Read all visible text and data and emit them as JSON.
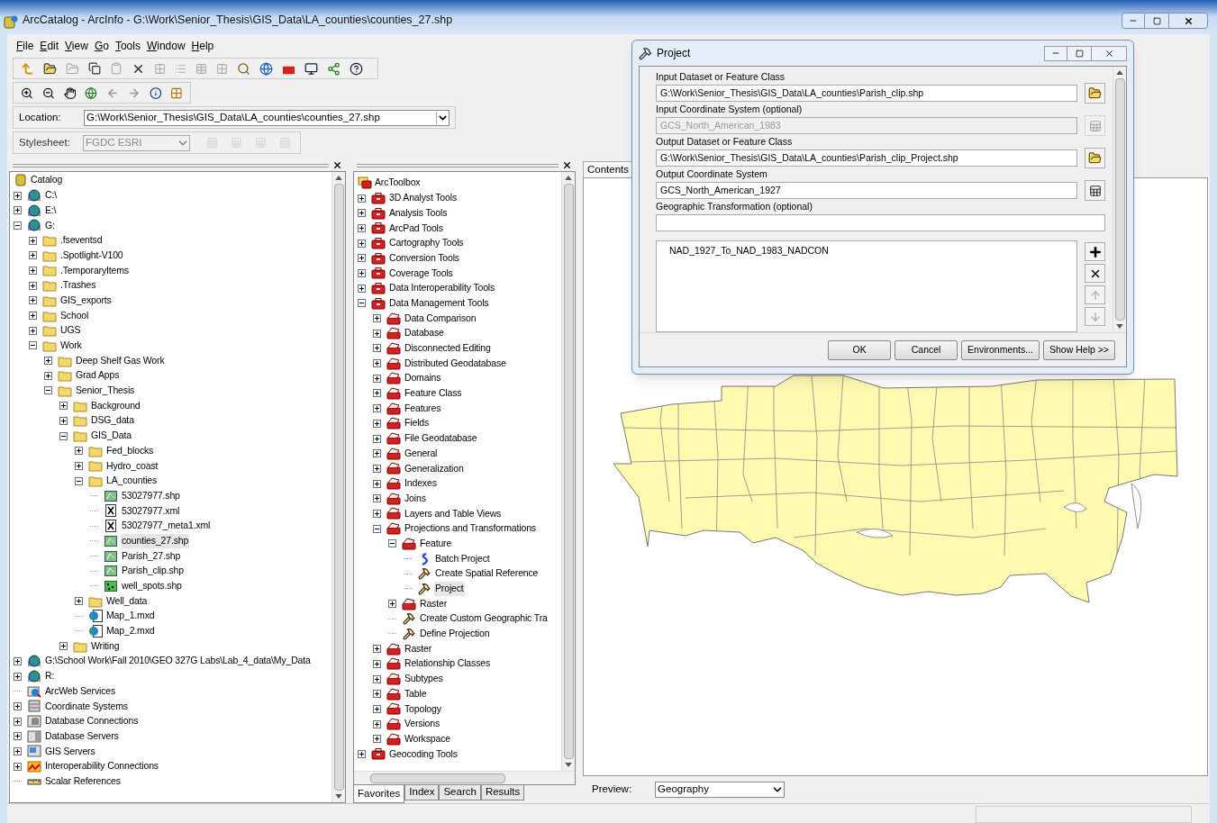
{
  "window": {
    "title": "ArcCatalog - ArcInfo - G:\\Work\\Senior_Thesis\\GIS_Data\\LA_counties\\counties_27.shp"
  },
  "menu": [
    "File",
    "Edit",
    "View",
    "Go",
    "Tools",
    "Window",
    "Help"
  ],
  "location": {
    "label": "Location:",
    "value": "G:\\Work\\Senior_Thesis\\GIS_Data\\LA_counties\\counties_27.shp"
  },
  "stylesheet": {
    "label": "Stylesheet:",
    "value": "FGDC ESRI",
    "disabled": true
  },
  "catalog": {
    "root": {
      "label": "Catalog",
      "kind": "catalog"
    },
    "items": [
      {
        "label": "C:\\",
        "kind": "drive",
        "expanded": false,
        "selected": false
      },
      {
        "label": "E:\\",
        "kind": "drive",
        "expanded": false,
        "selected": false
      },
      {
        "label": "G:",
        "kind": "drive",
        "expanded": true,
        "selected": false,
        "children": [
          {
            "label": ".fseventsd",
            "kind": "folder",
            "expanded": false,
            "selected": false
          },
          {
            "label": ".Spotlight-V100",
            "kind": "folder",
            "expanded": false,
            "selected": false
          },
          {
            "label": ".TemporaryItems",
            "kind": "folder",
            "expanded": false,
            "selected": false
          },
          {
            "label": ".Trashes",
            "kind": "folder",
            "expanded": false,
            "selected": false
          },
          {
            "label": "GIS_exports",
            "kind": "folder",
            "expanded": false,
            "selected": false
          },
          {
            "label": "School",
            "kind": "folder",
            "expanded": false,
            "selected": false
          },
          {
            "label": "UGS",
            "kind": "folder",
            "expanded": false,
            "selected": false
          },
          {
            "label": "Work",
            "kind": "folder",
            "expanded": true,
            "selected": false,
            "children": [
              {
                "label": "Deep Shelf Gas Work",
                "kind": "folder",
                "expanded": false,
                "selected": false
              },
              {
                "label": "Grad Apps",
                "kind": "folder",
                "expanded": false,
                "selected": false
              },
              {
                "label": "Senior_Thesis",
                "kind": "folder",
                "expanded": true,
                "selected": false,
                "children": [
                  {
                    "label": "Background",
                    "kind": "folder",
                    "expanded": false,
                    "selected": false
                  },
                  {
                    "label": "DSG_data",
                    "kind": "folder",
                    "expanded": false,
                    "selected": false
                  },
                  {
                    "label": "GIS_Data",
                    "kind": "folder",
                    "expanded": true,
                    "selected": false,
                    "children": [
                      {
                        "label": "Fed_blocks",
                        "kind": "folder",
                        "expanded": false,
                        "selected": false
                      },
                      {
                        "label": "Hydro_coast",
                        "kind": "folder",
                        "expanded": false,
                        "selected": false
                      },
                      {
                        "label": "LA_counties",
                        "kind": "folder",
                        "expanded": true,
                        "selected": false,
                        "children": [
                          {
                            "label": "53027977.shp",
                            "kind": "shapefile",
                            "selected": false
                          },
                          {
                            "label": "53027977.xml",
                            "kind": "xml",
                            "selected": false
                          },
                          {
                            "label": "53027977_meta1.xml",
                            "kind": "xml",
                            "selected": false
                          },
                          {
                            "label": "counties_27.shp",
                            "kind": "shapefile",
                            "selected": true
                          },
                          {
                            "label": "Parish_27.shp",
                            "kind": "shapefile",
                            "selected": false
                          },
                          {
                            "label": "Parish_clip.shp",
                            "kind": "shapefile",
                            "selected": false
                          },
                          {
                            "label": "well_spots.shp",
                            "kind": "points",
                            "selected": false
                          }
                        ]
                      },
                      {
                        "label": "Well_data",
                        "kind": "folder",
                        "expanded": false,
                        "selected": false
                      },
                      {
                        "label": "Map_1.mxd",
                        "kind": "mxd",
                        "selected": false
                      },
                      {
                        "label": "Map_2.mxd",
                        "kind": "mxd",
                        "selected": false
                      }
                    ]
                  },
                  {
                    "label": "Writing",
                    "kind": "folder",
                    "expanded": false,
                    "selected": false
                  }
                ]
              }
            ]
          }
        ]
      },
      {
        "label": "G:\\School Work\\Fall 2010\\GEO 327G Labs\\Lab_4_data\\My_Data",
        "kind": "drive",
        "expanded": false,
        "selected": false
      },
      {
        "label": "R:",
        "kind": "drive",
        "expanded": false,
        "selected": false
      },
      {
        "label": "ArcWeb Services",
        "kind": "service",
        "selected": false
      },
      {
        "label": "Coordinate Systems",
        "kind": "coordsys",
        "expanded": false,
        "selected": false
      },
      {
        "label": "Database Connections",
        "kind": "dbconn",
        "expanded": false,
        "selected": false
      },
      {
        "label": "Database Servers",
        "kind": "dbserver",
        "expanded": false,
        "selected": false
      },
      {
        "label": "GIS Servers",
        "kind": "gisserver",
        "expanded": false,
        "selected": false
      },
      {
        "label": "Interoperability Connections",
        "kind": "interop",
        "expanded": false,
        "selected": false
      },
      {
        "label": "Scalar References",
        "kind": "scalar",
        "selected": false
      }
    ]
  },
  "toolbox": {
    "root": {
      "label": "ArcToolbox",
      "kind": "arctoolbox"
    },
    "items": [
      {
        "label": "3D Analyst Tools",
        "kind": "toolbox",
        "expanded": false,
        "selected": false
      },
      {
        "label": "Analysis Tools",
        "kind": "toolbox",
        "expanded": false,
        "selected": false
      },
      {
        "label": "ArcPad Tools",
        "kind": "toolbox",
        "expanded": false,
        "selected": false
      },
      {
        "label": "Cartography Tools",
        "kind": "toolbox",
        "expanded": false,
        "selected": false
      },
      {
        "label": "Conversion Tools",
        "kind": "toolbox",
        "expanded": false,
        "selected": false
      },
      {
        "label": "Coverage Tools",
        "kind": "toolbox",
        "expanded": false,
        "selected": false
      },
      {
        "label": "Data Interoperability Tools",
        "kind": "toolbox",
        "expanded": false,
        "selected": false
      },
      {
        "label": "Data Management Tools",
        "kind": "toolbox",
        "expanded": true,
        "selected": false,
        "children": [
          {
            "label": "Data Comparison",
            "kind": "toolset",
            "expanded": false,
            "selected": false
          },
          {
            "label": "Database",
            "kind": "toolset",
            "expanded": false,
            "selected": false
          },
          {
            "label": "Disconnected Editing",
            "kind": "toolset",
            "expanded": false,
            "selected": false
          },
          {
            "label": "Distributed Geodatabase",
            "kind": "toolset",
            "expanded": false,
            "selected": false
          },
          {
            "label": "Domains",
            "kind": "toolset",
            "expanded": false,
            "selected": false
          },
          {
            "label": "Feature Class",
            "kind": "toolset",
            "expanded": false,
            "selected": false
          },
          {
            "label": "Features",
            "kind": "toolset",
            "expanded": false,
            "selected": false
          },
          {
            "label": "Fields",
            "kind": "toolset",
            "expanded": false,
            "selected": false
          },
          {
            "label": "File Geodatabase",
            "kind": "toolset",
            "expanded": false,
            "selected": false
          },
          {
            "label": "General",
            "kind": "toolset",
            "expanded": false,
            "selected": false
          },
          {
            "label": "Generalization",
            "kind": "toolset",
            "expanded": false,
            "selected": false
          },
          {
            "label": "Indexes",
            "kind": "toolset",
            "expanded": false,
            "selected": false
          },
          {
            "label": "Joins",
            "kind": "toolset",
            "expanded": false,
            "selected": false
          },
          {
            "label": "Layers and Table Views",
            "kind": "toolset",
            "expanded": false,
            "selected": false
          },
          {
            "label": "Projections and Transformations",
            "kind": "toolset",
            "expanded": true,
            "selected": false,
            "children": [
              {
                "label": "Feature",
                "kind": "toolset",
                "expanded": true,
                "selected": false,
                "children": [
                  {
                    "label": "Batch Project",
                    "kind": "batch",
                    "selected": false
                  },
                  {
                    "label": "Create Spatial Reference",
                    "kind": "tool",
                    "selected": false
                  },
                  {
                    "label": "Project",
                    "kind": "tool",
                    "selected": true
                  }
                ]
              },
              {
                "label": "Raster",
                "kind": "toolset",
                "expanded": false,
                "selected": false
              },
              {
                "label": "Create Custom Geographic Tra",
                "kind": "tool",
                "selected": false
              },
              {
                "label": "Define Projection",
                "kind": "tool",
                "selected": false
              }
            ]
          },
          {
            "label": "Raster",
            "kind": "toolset",
            "expanded": false,
            "selected": false
          },
          {
            "label": "Relationship Classes",
            "kind": "toolset",
            "expanded": false,
            "selected": false
          },
          {
            "label": "Subtypes",
            "kind": "toolset",
            "expanded": false,
            "selected": false
          },
          {
            "label": "Table",
            "kind": "toolset",
            "expanded": false,
            "selected": false
          },
          {
            "label": "Topology",
            "kind": "toolset",
            "expanded": false,
            "selected": false
          },
          {
            "label": "Versions",
            "kind": "toolset",
            "expanded": false,
            "selected": false
          },
          {
            "label": "Workspace",
            "kind": "toolset",
            "expanded": false,
            "selected": false
          }
        ]
      },
      {
        "label": "Geocoding Tools",
        "kind": "toolbox",
        "expanded": false,
        "selected": false
      }
    ],
    "tabs": [
      {
        "label": "Favorites",
        "selected": true
      },
      {
        "label": "Index",
        "selected": false
      },
      {
        "label": "Search",
        "selected": false
      },
      {
        "label": "Results",
        "selected": false
      }
    ]
  },
  "contents": {
    "tab": "Contents",
    "preview": {
      "label": "Preview:",
      "value": "Geography"
    }
  },
  "dialog": {
    "title": "Project",
    "fields": [
      {
        "label": "Input Dataset or Feature Class",
        "value": "G:\\Work\\Senior_Thesis\\GIS_Data\\LA_counties\\Parish_clip.shp",
        "disabled": false,
        "kind": "browse"
      },
      {
        "label": "Input Coordinate System (optional)",
        "value": "GCS_North_American_1983",
        "disabled": true,
        "kind": "coordsys"
      },
      {
        "label": "Output Dataset or Feature Class",
        "value": "G:\\Work\\Senior_Thesis\\GIS_Data\\LA_counties\\Parish_clip_Project.shp",
        "disabled": false,
        "kind": "browse"
      },
      {
        "label": "Output Coordinate System",
        "value": "GCS_North_American_1927",
        "disabled": false,
        "kind": "coordsys"
      },
      {
        "label": "Geographic Transformation (optional)",
        "disabled": false,
        "kind": "plain"
      }
    ],
    "transformations": [
      "NAD_1927_To_NAD_1983_NADCON"
    ],
    "list_buttons": [
      {
        "kind": "add",
        "disabled": false
      },
      {
        "kind": "remove",
        "disabled": false
      },
      {
        "kind": "up",
        "disabled": true
      },
      {
        "kind": "down",
        "disabled": true
      }
    ],
    "buttons": [
      "OK",
      "Cancel",
      "Environments...",
      "Show Help >>"
    ]
  }
}
